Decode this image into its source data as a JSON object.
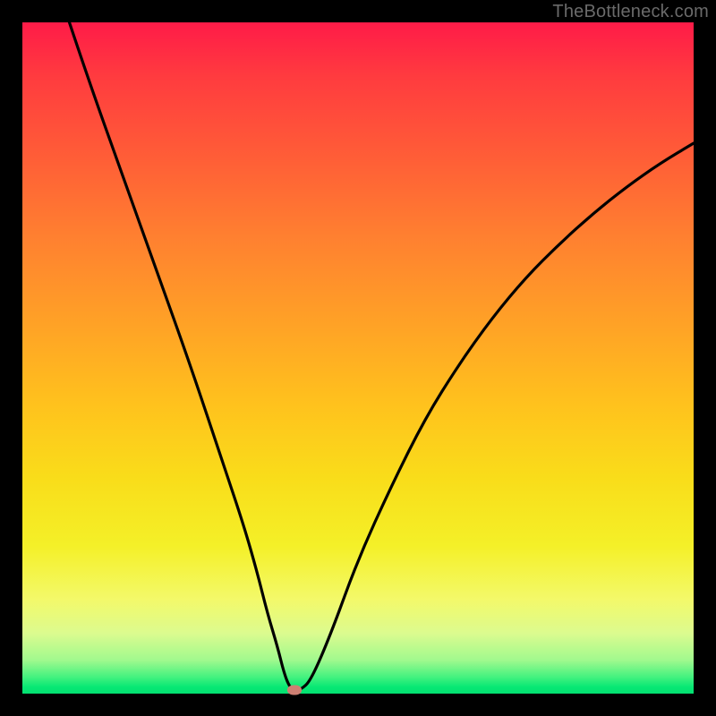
{
  "watermark": "TheBottleneck.com",
  "marker_color": "#cd7f72",
  "chart_data": {
    "type": "line",
    "title": "",
    "xlabel": "",
    "ylabel": "",
    "xlim": [
      0,
      100
    ],
    "ylim": [
      0,
      100
    ],
    "series": [
      {
        "name": "curve",
        "x": [
          7,
          10,
          15,
          20,
          25,
          30,
          33,
          35,
          36.5,
          38,
          39,
          39.8,
          40.5,
          41.5,
          43,
          46,
          50,
          55,
          60,
          65,
          70,
          75,
          80,
          85,
          90,
          95,
          100
        ],
        "y": [
          100,
          91,
          77,
          63,
          49,
          34,
          25,
          18,
          12,
          7,
          3,
          1,
          0.5,
          0.6,
          2,
          9,
          20,
          31,
          41,
          49,
          56,
          62,
          67,
          71.5,
          75.5,
          79,
          82
        ]
      }
    ],
    "marker": {
      "x": 40.5,
      "y": 0.5
    },
    "gradient_stops": [
      {
        "pos": 0,
        "color": "#ff1b48"
      },
      {
        "pos": 0.5,
        "color": "#ffc21d"
      },
      {
        "pos": 0.85,
        "color": "#f3f96a"
      },
      {
        "pos": 1.0,
        "color": "#03e071"
      }
    ]
  }
}
